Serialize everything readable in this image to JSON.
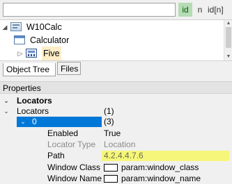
{
  "search": {
    "value": "",
    "placeholder": ""
  },
  "mode_buttons": {
    "id": "id",
    "n": "n",
    "idn": "id[n]"
  },
  "tree": {
    "nodes": [
      {
        "label": "W10Calc",
        "icon": "tree-root-icon"
      },
      {
        "label": "Calculator",
        "icon": "window-icon"
      },
      {
        "label": "Five",
        "icon": "calculator-app-icon",
        "expander": "▷"
      }
    ]
  },
  "tabs": {
    "object_tree": "Object Tree",
    "files": "Files"
  },
  "properties": {
    "header": "Properties",
    "category": "Locators",
    "locators": {
      "label": "Locators",
      "value": "(1)"
    },
    "locator0": {
      "label": "0",
      "value": "(3)"
    },
    "fields": {
      "enabled": {
        "label": "Enabled",
        "value": "True"
      },
      "locator_type": {
        "label": "Locator Type",
        "value": "Location"
      },
      "path": {
        "label": "Path",
        "value": "4.2.4.4.7.6"
      },
      "window_class": {
        "label": "Window Class",
        "value": "param:window_class"
      },
      "window_name": {
        "label": "Window Name",
        "value": "param:window_name"
      }
    }
  },
  "colors": {
    "selection": "#0078d7",
    "path_highlight": "#f6f77a",
    "id_mode_active": "#b6dcb6",
    "tree_selected": "#fdeec8"
  }
}
